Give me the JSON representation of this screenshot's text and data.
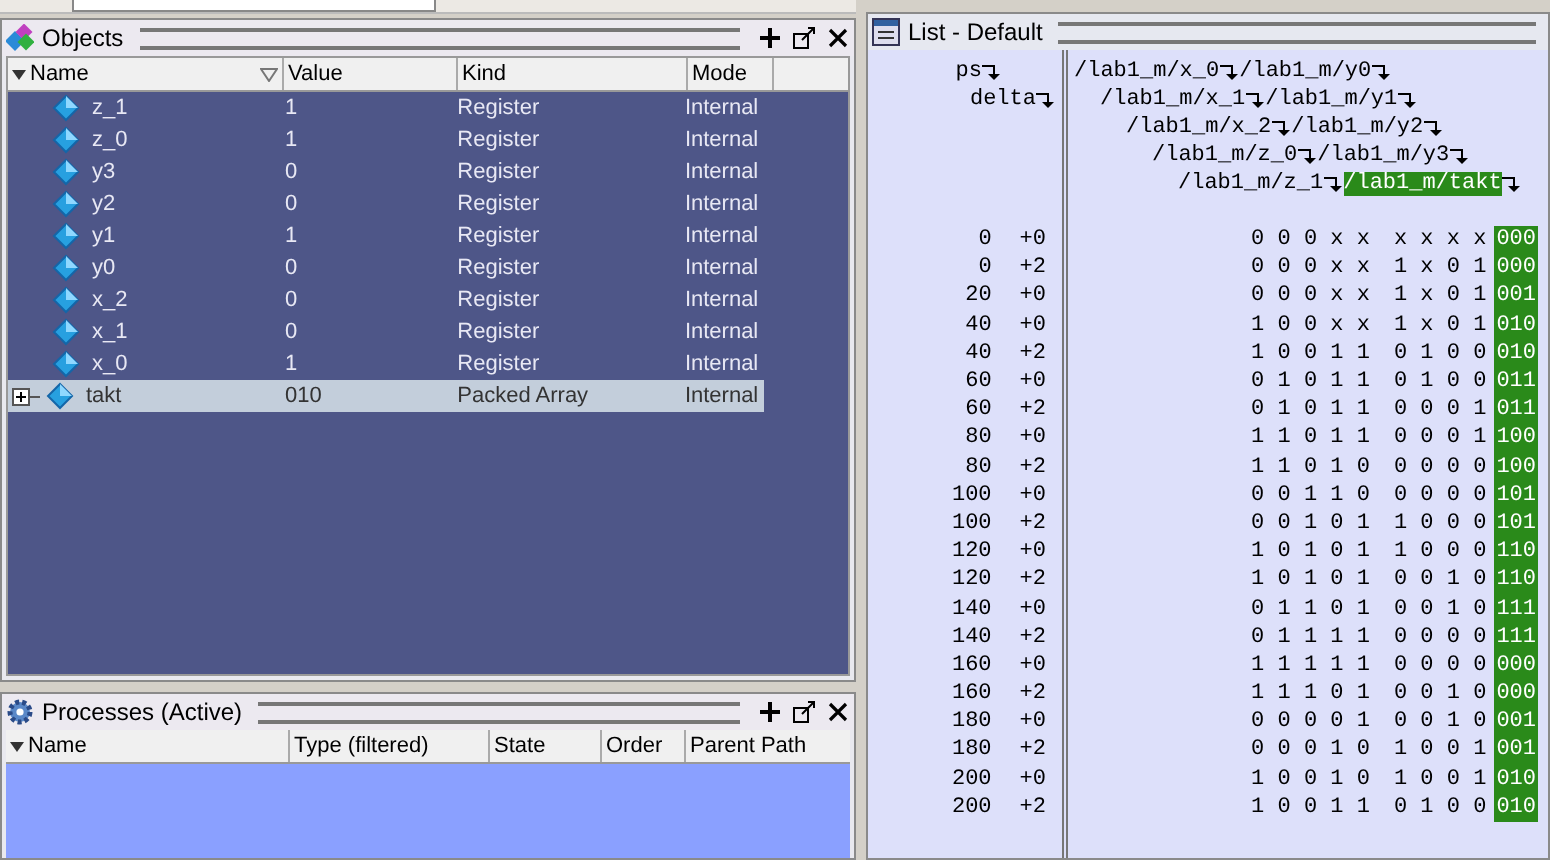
{
  "objects": {
    "title": "Objects",
    "columns": [
      "Name",
      "Value",
      "Kind",
      "Mode"
    ],
    "rows": [
      {
        "name": "z_1",
        "value": "1",
        "kind": "Register",
        "mode": "Internal",
        "expandable": false,
        "selected": false
      },
      {
        "name": "z_0",
        "value": "1",
        "kind": "Register",
        "mode": "Internal",
        "expandable": false,
        "selected": false
      },
      {
        "name": "y3",
        "value": "0",
        "kind": "Register",
        "mode": "Internal",
        "expandable": false,
        "selected": false
      },
      {
        "name": "y2",
        "value": "0",
        "kind": "Register",
        "mode": "Internal",
        "expandable": false,
        "selected": false
      },
      {
        "name": "y1",
        "value": "1",
        "kind": "Register",
        "mode": "Internal",
        "expandable": false,
        "selected": false
      },
      {
        "name": "y0",
        "value": "0",
        "kind": "Register",
        "mode": "Internal",
        "expandable": false,
        "selected": false
      },
      {
        "name": "x_2",
        "value": "0",
        "kind": "Register",
        "mode": "Internal",
        "expandable": false,
        "selected": false
      },
      {
        "name": "x_1",
        "value": "0",
        "kind": "Register",
        "mode": "Internal",
        "expandable": false,
        "selected": false
      },
      {
        "name": "x_0",
        "value": "1",
        "kind": "Register",
        "mode": "Internal",
        "expandable": false,
        "selected": false
      },
      {
        "name": "takt",
        "value": "010",
        "kind": "Packed Array",
        "mode": "Internal",
        "expandable": true,
        "selected": true
      }
    ]
  },
  "processes": {
    "title": "Processes (Active)",
    "columns": [
      "Name",
      "Type (filtered)",
      "State",
      "Order",
      "Parent Path"
    ]
  },
  "list": {
    "title": "List - Default",
    "time_signals": [
      "ps",
      "delta"
    ],
    "signal_lines": [
      [
        {
          "name": "/lab1_m/x_0",
          "selected": false
        },
        {
          "name": "/lab1_m/y0",
          "selected": false
        }
      ],
      [
        {
          "name": "/lab1_m/x_1",
          "selected": false
        },
        {
          "name": "/lab1_m/y1",
          "selected": false
        }
      ],
      [
        {
          "name": "/lab1_m/x_2",
          "selected": false
        },
        {
          "name": "/lab1_m/y2",
          "selected": false
        }
      ],
      [
        {
          "name": "/lab1_m/z_0",
          "selected": false
        },
        {
          "name": "/lab1_m/y3",
          "selected": false
        }
      ],
      [
        {
          "name": "/lab1_m/z_1",
          "selected": false
        },
        {
          "name": "/lab1_m/takt",
          "selected": true
        }
      ]
    ],
    "rows": [
      {
        "time": "0",
        "delta": "+0",
        "bits": "0 0 0 x x",
        "bits_2": "x x x x",
        "takt": "000"
      },
      {
        "time": "0",
        "delta": "+2",
        "bits": "0 0 0 x x",
        "bits_2": "1 x 0 1",
        "takt": "000"
      },
      {
        "time": "20",
        "delta": "+0",
        "bits": "0 0 0 x x",
        "bits_2": "1 x 0 1",
        "takt": "001"
      },
      {
        "time": "40",
        "delta": "+0",
        "bits": "1 0 0 x x",
        "bits_2": "1 x 0 1",
        "takt": "010"
      },
      {
        "time": "40",
        "delta": "+2",
        "bits": "1 0 0 1 1",
        "bits_2": "0 1 0 0",
        "takt": "010"
      },
      {
        "time": "60",
        "delta": "+0",
        "bits": "0 1 0 1 1",
        "bits_2": "0 1 0 0",
        "takt": "011"
      },
      {
        "time": "60",
        "delta": "+2",
        "bits": "0 1 0 1 1",
        "bits_2": "0 0 0 1",
        "takt": "011"
      },
      {
        "time": "80",
        "delta": "+0",
        "bits": "1 1 0 1 1",
        "bits_2": "0 0 0 1",
        "takt": "100"
      },
      {
        "time": "80",
        "delta": "+2",
        "bits": "1 1 0 1 0",
        "bits_2": "0 0 0 0",
        "takt": "100"
      },
      {
        "time": "100",
        "delta": "+0",
        "bits": "0 0 1 1 0",
        "bits_2": "0 0 0 0",
        "takt": "101"
      },
      {
        "time": "100",
        "delta": "+2",
        "bits": "0 0 1 0 1",
        "bits_2": "1 0 0 0",
        "takt": "101"
      },
      {
        "time": "120",
        "delta": "+0",
        "bits": "1 0 1 0 1",
        "bits_2": "1 0 0 0",
        "takt": "110"
      },
      {
        "time": "120",
        "delta": "+2",
        "bits": "1 0 1 0 1",
        "bits_2": "0 0 1 0",
        "takt": "110"
      },
      {
        "time": "140",
        "delta": "+0",
        "bits": "0 1 1 0 1",
        "bits_2": "0 0 1 0",
        "takt": "111"
      },
      {
        "time": "140",
        "delta": "+2",
        "bits": "0 1 1 1 1",
        "bits_2": "0 0 0 0",
        "takt": "111"
      },
      {
        "time": "160",
        "delta": "+0",
        "bits": "1 1 1 1 1",
        "bits_2": "0 0 0 0",
        "takt": "000"
      },
      {
        "time": "160",
        "delta": "+2",
        "bits": "1 1 1 0 1",
        "bits_2": "0 0 1 0",
        "takt": "000"
      },
      {
        "time": "180",
        "delta": "+0",
        "bits": "0 0 0 0 1",
        "bits_2": "0 0 1 0",
        "takt": "001"
      },
      {
        "time": "180",
        "delta": "+2",
        "bits": "0 0 0 1 0",
        "bits_2": "1 0 0 1",
        "takt": "001"
      },
      {
        "time": "200",
        "delta": "+0",
        "bits": "1 0 0 1 0",
        "bits_2": "1 0 0 1",
        "takt": "010"
      },
      {
        "time": "200",
        "delta": "+2",
        "bits": "1 0 0 1 1",
        "bits_2": "0 1 0 0",
        "takt": "010"
      }
    ]
  }
}
